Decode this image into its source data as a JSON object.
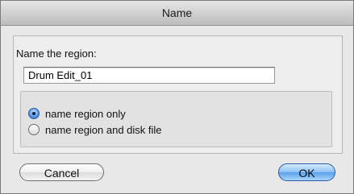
{
  "window": {
    "title": "Name"
  },
  "form": {
    "prompt_label": "Name the region:",
    "name_value": "Drum Edit_01"
  },
  "options": {
    "selected": "name_region_only",
    "items": [
      {
        "id": "name_region_only",
        "label": "name region only",
        "checked": true
      },
      {
        "id": "name_region_and_disk_file",
        "label": "name region and disk file",
        "checked": false
      }
    ]
  },
  "buttons": {
    "cancel_label": "Cancel",
    "ok_label": "OK"
  },
  "colors": {
    "accent": "#5aa0e8",
    "dialog_bg": "#e8e8e8"
  }
}
